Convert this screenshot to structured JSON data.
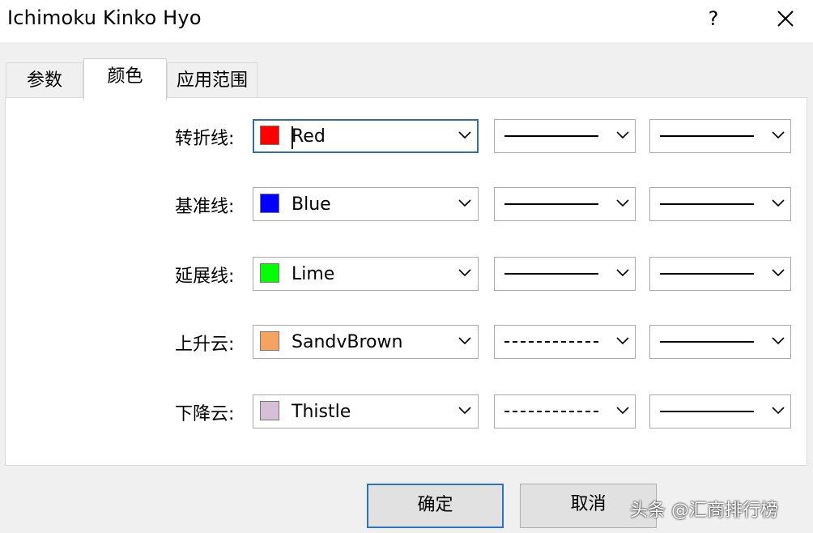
{
  "window": {
    "title": "Ichimoku Kinko Hyo",
    "help_label": "?"
  },
  "tabs": [
    {
      "label": "参数",
      "active": false
    },
    {
      "label": "颜色",
      "active": true
    },
    {
      "label": "应用范围",
      "active": false
    }
  ],
  "rows": [
    {
      "label": "转折线:",
      "color_name": "Red",
      "color_hex": "#ff0000",
      "style": "solid",
      "width": "solid"
    },
    {
      "label": "基准线:",
      "color_name": "Blue",
      "color_hex": "#0000ff",
      "style": "solid",
      "width": "solid"
    },
    {
      "label": "延展线:",
      "color_name": "Lime",
      "color_hex": "#00ff00",
      "style": "solid",
      "width": "solid"
    },
    {
      "label": "上升云:",
      "color_name": "SandvBrown",
      "color_hex": "#f4a460",
      "style": "dashed",
      "width": "solid"
    },
    {
      "label": "下降云:",
      "color_name": "Thistle",
      "color_hex": "#d8bfd8",
      "style": "dashed",
      "width": "solid"
    }
  ],
  "buttons": {
    "ok": "确定",
    "cancel": "取消"
  },
  "watermark": "头条 @汇商排行榜",
  "icons": {
    "help": "help-icon",
    "close": "close-icon",
    "dropdown": "chevron-down-icon"
  },
  "colors": {
    "accent": "#2b74c4",
    "panel_bg": "#ffffff",
    "window_bg": "#f0f0f0"
  }
}
